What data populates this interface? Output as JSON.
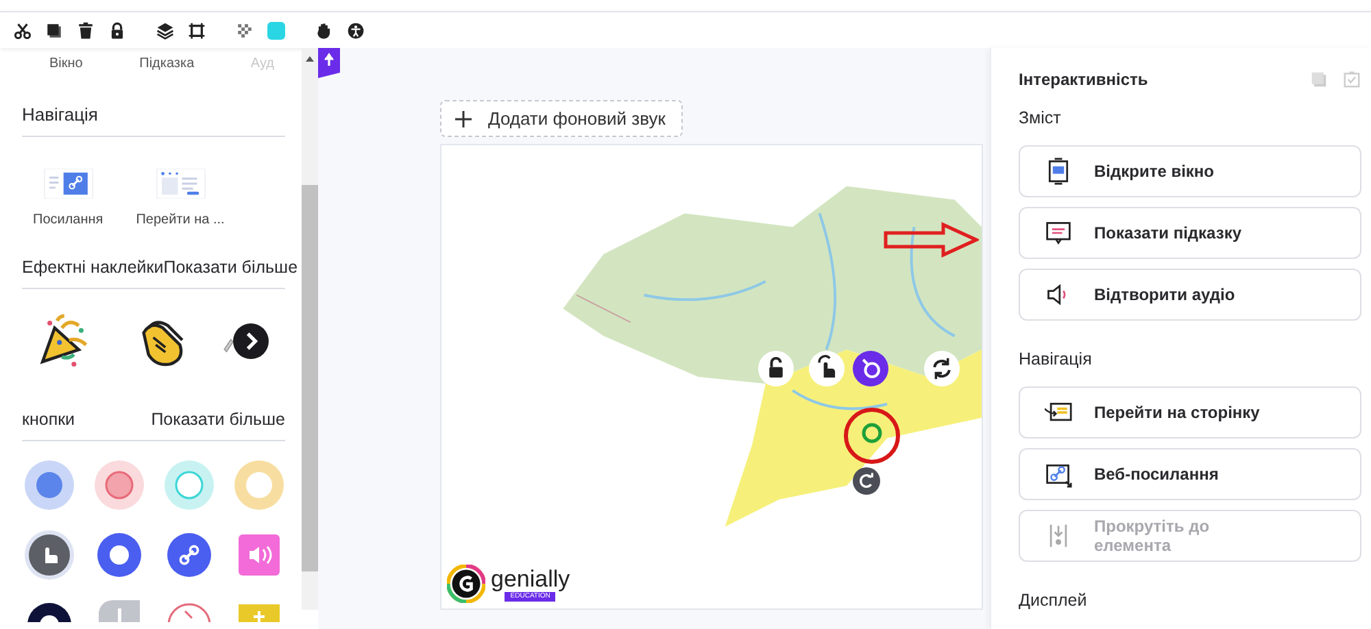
{
  "left_panel": {
    "top_items": [
      {
        "label": "Вікно",
        "faded": false
      },
      {
        "label": "Підказка",
        "faded": false
      },
      {
        "label": "Ауд",
        "faded": true
      }
    ],
    "navigation": {
      "title": "Навігація",
      "items": [
        {
          "label": "Посилання",
          "kind": "link"
        },
        {
          "label": "Перейти на ...",
          "kind": "page"
        }
      ]
    },
    "stickers": {
      "title": "Ефектні наклейки",
      "more": "Показати більше"
    },
    "buttons": {
      "title": "кнопки",
      "more": "Показати більше"
    }
  },
  "canvas": {
    "add_sound_button": "Додати фоновий звук",
    "logo": {
      "name": "genially",
      "badge": "EDUCATION"
    }
  },
  "right_panel": {
    "title": "Інтерактивність",
    "sections": [
      {
        "title": "Зміст",
        "actions": [
          {
            "label": "Відкрите вікно",
            "kind": "window",
            "disabled": false
          },
          {
            "label": "Показати підказку",
            "kind": "tooltip",
            "disabled": false
          },
          {
            "label": "Відтворити аудіо",
            "kind": "audio",
            "disabled": false
          }
        ]
      },
      {
        "title": "Навігація",
        "actions": [
          {
            "label": "Перейти на сторінку",
            "kind": "page",
            "disabled": false
          },
          {
            "label": "Веб-посилання",
            "kind": "link",
            "disabled": false
          },
          {
            "label": "Прокрутіть до елемента",
            "kind": "scroll",
            "disabled": true
          }
        ]
      },
      {
        "title": "Дисплей"
      }
    ]
  }
}
